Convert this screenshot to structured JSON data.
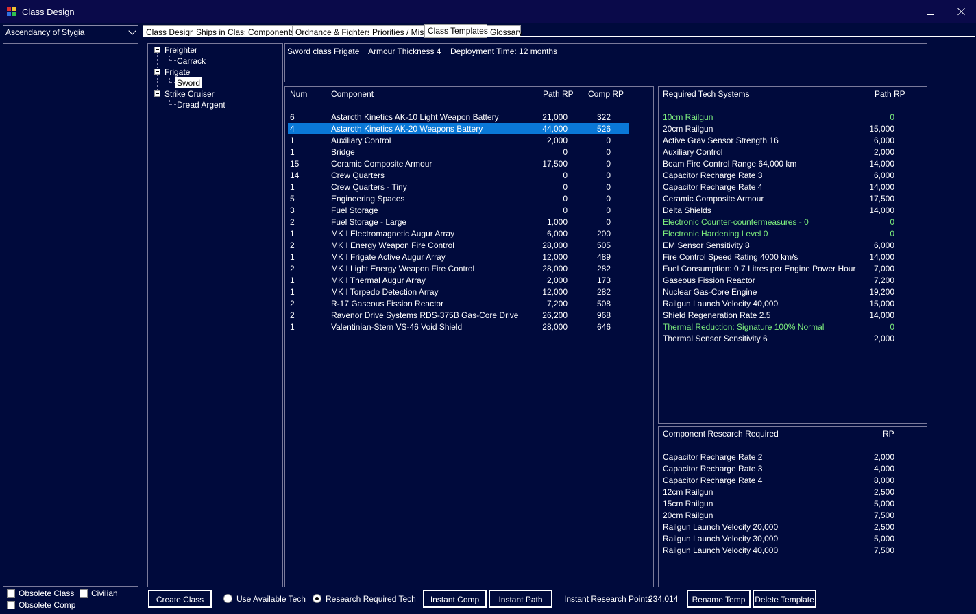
{
  "window": {
    "title": "Class Design",
    "icon": "class-design-app-icon",
    "controls": [
      "minimize-icon",
      "maximize-icon",
      "close-icon"
    ]
  },
  "race_select": {
    "value": "Ascendancy of Stygia"
  },
  "left_options": {
    "obsolete_class": "Obsolete Class",
    "civilian": "Civilian",
    "obsolete_comp": "Obsolete Comp"
  },
  "tabs": [
    {
      "label": "Class Design"
    },
    {
      "label": "Ships in Class"
    },
    {
      "label": "Components"
    },
    {
      "label": "Ordnance & Fighters"
    },
    {
      "label": "Priorities / Misc"
    },
    {
      "label": "Class Templates"
    },
    {
      "label": "Glossary"
    }
  ],
  "active_tab": "Class Templates",
  "tree": {
    "groups": [
      {
        "label": "Freighter",
        "children": [
          "Carrack"
        ]
      },
      {
        "label": "Frigate",
        "children": [
          "Sword"
        ]
      },
      {
        "label": "Strike Cruiser",
        "children": [
          "Dread Argent"
        ]
      }
    ],
    "selected": "Sword"
  },
  "summary": {
    "class_name": "Sword class Frigate",
    "armour": "Armour Thickness 4",
    "deployment": "Deployment Time: 12 months"
  },
  "components": {
    "headers": {
      "num": "Num",
      "component": "Component",
      "path_rp": "Path RP",
      "comp_rp": "Comp RP"
    },
    "selected_index": 1,
    "rows": [
      {
        "num": "6",
        "name": "Astaroth Kinetics AK-10 Light Weapon Battery",
        "path_rp": "21,000",
        "comp_rp": "322"
      },
      {
        "num": "4",
        "name": "Astaroth Kinetics AK-20 Weapons Battery",
        "path_rp": "44,000",
        "comp_rp": "526"
      },
      {
        "num": "1",
        "name": "Auxiliary Control",
        "path_rp": "2,000",
        "comp_rp": "0"
      },
      {
        "num": "1",
        "name": "Bridge",
        "path_rp": "0",
        "comp_rp": "0"
      },
      {
        "num": "15",
        "name": "Ceramic Composite Armour",
        "path_rp": "17,500",
        "comp_rp": "0"
      },
      {
        "num": "14",
        "name": "Crew Quarters",
        "path_rp": "0",
        "comp_rp": "0"
      },
      {
        "num": "1",
        "name": "Crew Quarters - Tiny",
        "path_rp": "0",
        "comp_rp": "0"
      },
      {
        "num": "5",
        "name": "Engineering Spaces",
        "path_rp": "0",
        "comp_rp": "0"
      },
      {
        "num": "3",
        "name": "Fuel Storage",
        "path_rp": "0",
        "comp_rp": "0"
      },
      {
        "num": "2",
        "name": "Fuel Storage - Large",
        "path_rp": "1,000",
        "comp_rp": "0"
      },
      {
        "num": "1",
        "name": "MK I Electromagnetic Augur Array",
        "path_rp": "6,000",
        "comp_rp": "200"
      },
      {
        "num": "2",
        "name": "MK I Energy Weapon Fire Control",
        "path_rp": "28,000",
        "comp_rp": "505"
      },
      {
        "num": "1",
        "name": "MK I Frigate Active Augur Array",
        "path_rp": "12,000",
        "comp_rp": "489"
      },
      {
        "num": "2",
        "name": "MK I Light Energy Weapon Fire Control",
        "path_rp": "28,000",
        "comp_rp": "282"
      },
      {
        "num": "1",
        "name": "MK I Thermal Augur Array",
        "path_rp": "2,000",
        "comp_rp": "173"
      },
      {
        "num": "1",
        "name": "MK I Torpedo Detection Array",
        "path_rp": "12,000",
        "comp_rp": "282"
      },
      {
        "num": "2",
        "name": "R-17 Gaseous Fission Reactor",
        "path_rp": "7,200",
        "comp_rp": "508"
      },
      {
        "num": "2",
        "name": "Ravenor Drive Systems RDS-375B Gas-Core Drive",
        "path_rp": "26,200",
        "comp_rp": "968"
      },
      {
        "num": "1",
        "name": "Valentinian-Stern VS-46 Void Shield",
        "path_rp": "28,000",
        "comp_rp": "646"
      }
    ]
  },
  "tech": {
    "headers": {
      "name": "Required Tech Systems",
      "path_rp": "Path RP"
    },
    "highlight_color": "#7ef07e",
    "rows": [
      {
        "name": "10cm Railgun",
        "rp": "0",
        "green": true
      },
      {
        "name": "20cm Railgun",
        "rp": "15,000"
      },
      {
        "name": "Active Grav Sensor Strength 16",
        "rp": "6,000"
      },
      {
        "name": "Auxiliary Control",
        "rp": "2,000"
      },
      {
        "name": "Beam Fire Control Range 64,000 km",
        "rp": "14,000"
      },
      {
        "name": "Capacitor Recharge Rate 3",
        "rp": "6,000"
      },
      {
        "name": "Capacitor Recharge Rate 4",
        "rp": "14,000"
      },
      {
        "name": "Ceramic Composite Armour",
        "rp": "17,500"
      },
      {
        "name": "Delta Shields",
        "rp": "14,000"
      },
      {
        "name": "Electronic Counter-countermeasures - 0",
        "rp": "0",
        "green": true
      },
      {
        "name": "Electronic Hardening Level 0",
        "rp": "0",
        "green": true
      },
      {
        "name": "EM Sensor Sensitivity 8",
        "rp": "6,000"
      },
      {
        "name": "Fire Control Speed Rating 4000 km/s",
        "rp": "14,000"
      },
      {
        "name": "Fuel Consumption: 0.7 Litres per Engine Power Hour",
        "rp": "7,000"
      },
      {
        "name": "Gaseous Fission Reactor",
        "rp": "7,200"
      },
      {
        "name": "Nuclear Gas-Core Engine",
        "rp": "19,200"
      },
      {
        "name": "Railgun Launch Velocity 40,000",
        "rp": "15,000"
      },
      {
        "name": "Shield Regeneration Rate 2.5",
        "rp": "14,000"
      },
      {
        "name": "Thermal Reduction: Signature 100% Normal",
        "rp": "0",
        "green": true
      },
      {
        "name": "Thermal Sensor Sensitivity 6",
        "rp": "2,000"
      }
    ]
  },
  "research": {
    "headers": {
      "name": "Component Research Required",
      "rp": "RP"
    },
    "rows": [
      {
        "name": "Capacitor Recharge Rate 2",
        "rp": "2,000"
      },
      {
        "name": "Capacitor Recharge Rate 3",
        "rp": "4,000"
      },
      {
        "name": "Capacitor Recharge Rate 4",
        "rp": "8,000"
      },
      {
        "name": "12cm Railgun",
        "rp": "2,500"
      },
      {
        "name": "15cm Railgun",
        "rp": "5,000"
      },
      {
        "name": "20cm Railgun",
        "rp": "7,500"
      },
      {
        "name": "Railgun Launch Velocity 20,000",
        "rp": "2,500"
      },
      {
        "name": "Railgun Launch Velocity 30,000",
        "rp": "5,000"
      },
      {
        "name": "Railgun Launch Velocity 40,000",
        "rp": "7,500"
      }
    ]
  },
  "bottom": {
    "create_class": "Create Class",
    "use_available_tech": "Use Available Tech",
    "research_required_tech": "Research Required Tech",
    "radio_selected": "research_required_tech",
    "instant_comp": "Instant Comp",
    "instant_path": "Instant Path",
    "instant_rp_label": "Instant Research Points",
    "instant_rp_value": "234,014",
    "rename_temp": "Rename Temp",
    "delete_template": "Delete Template"
  }
}
